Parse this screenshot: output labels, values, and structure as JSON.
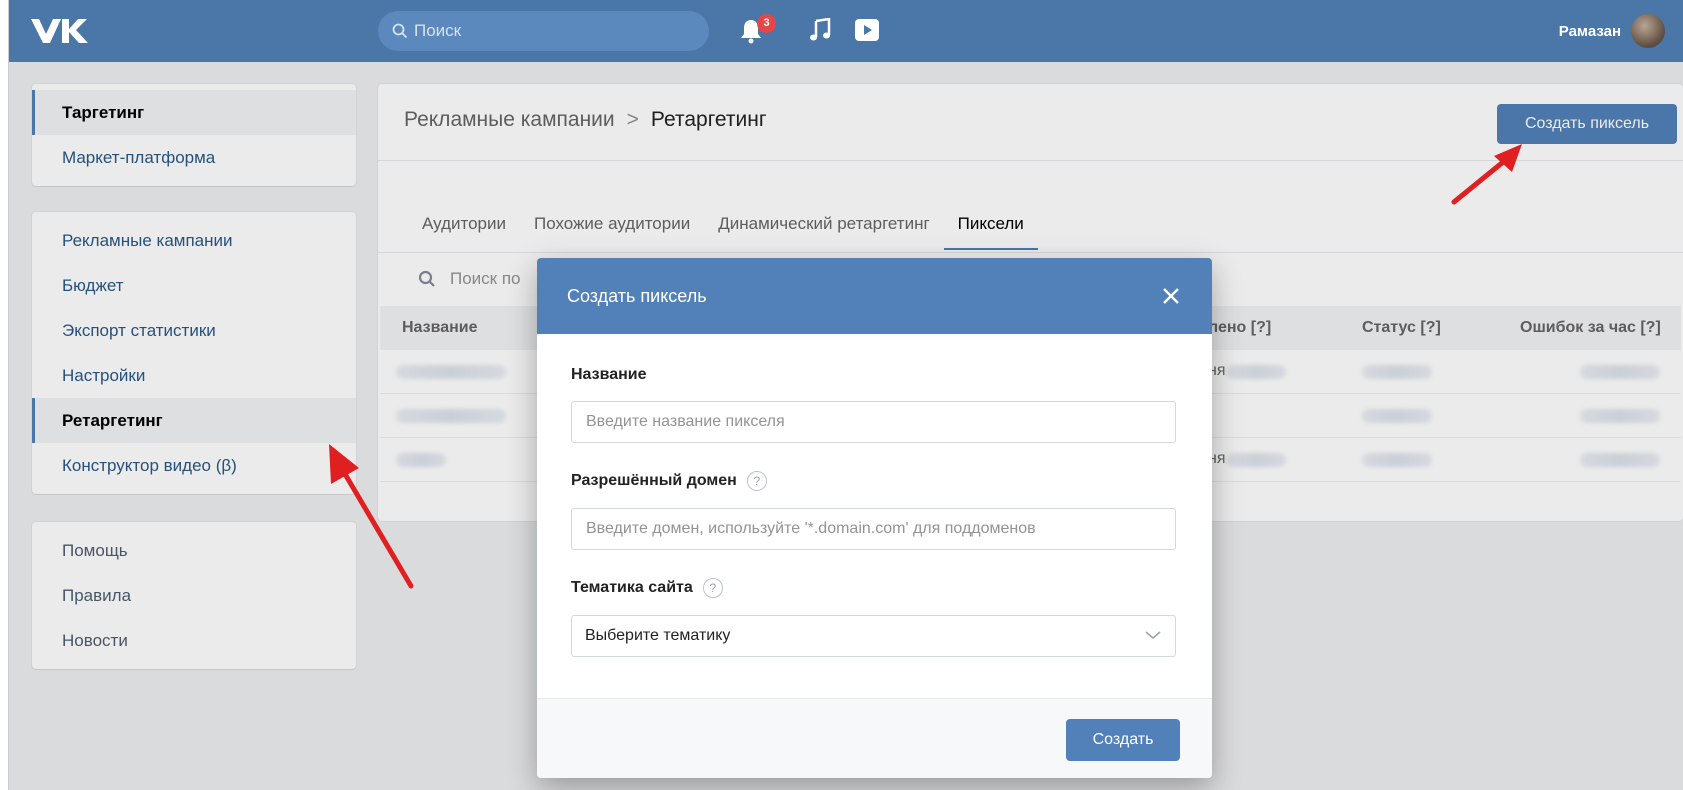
{
  "header": {
    "search_placeholder": "Поиск",
    "notifications_count": "3",
    "user_name": "Рамазан"
  },
  "sidebar": {
    "group1": [
      {
        "label": "Таргетинг",
        "active": true
      },
      {
        "label": "Маркет-платформа",
        "active": false
      }
    ],
    "group2": [
      {
        "label": "Рекламные кампании",
        "active": false
      },
      {
        "label": "Бюджет",
        "active": false
      },
      {
        "label": "Экспорт статистики",
        "active": false
      },
      {
        "label": "Настройки",
        "active": false
      },
      {
        "label": "Ретаргетинг",
        "active": true
      },
      {
        "label": "Конструктор видео (β)",
        "active": false
      }
    ],
    "group3": [
      {
        "label": "Помощь"
      },
      {
        "label": "Правила"
      },
      {
        "label": "Новости"
      }
    ]
  },
  "main": {
    "breadcrumb": {
      "parent": "Рекламные кампании",
      "separator": ">",
      "current": "Ретаргетинг"
    },
    "create_pixel_button": "Создать пиксель",
    "tabs": [
      {
        "label": "Аудитории",
        "active": false
      },
      {
        "label": "Похожие аудитории",
        "active": false
      },
      {
        "label": "Динамический ретаргетинг",
        "active": false
      },
      {
        "label": "Пиксели",
        "active": true
      }
    ],
    "table_search_placeholder": "Поиск по",
    "table": {
      "headers": [
        "Название",
        "лено [?]",
        "Статус [?]",
        "Ошибок за час [?]"
      ],
      "rows": [
        {
          "partial": "ня"
        },
        {
          "partial": ""
        },
        {
          "partial": "ня"
        }
      ]
    }
  },
  "modal": {
    "title": "Создать пиксель",
    "name_label": "Название",
    "name_placeholder": "Введите название пикселя",
    "domain_label": "Разрешённый домен",
    "domain_placeholder": "Введите домен, используйте '*.domain.com' для поддоменов",
    "theme_label": "Тематика сайта",
    "theme_value": "Выберите тематику",
    "help_glyph": "?",
    "submit_label": "Создать"
  },
  "colors": {
    "header_bg": "#4a76a8",
    "accent": "#5181b8",
    "annotation_arrow": "#e02020"
  }
}
